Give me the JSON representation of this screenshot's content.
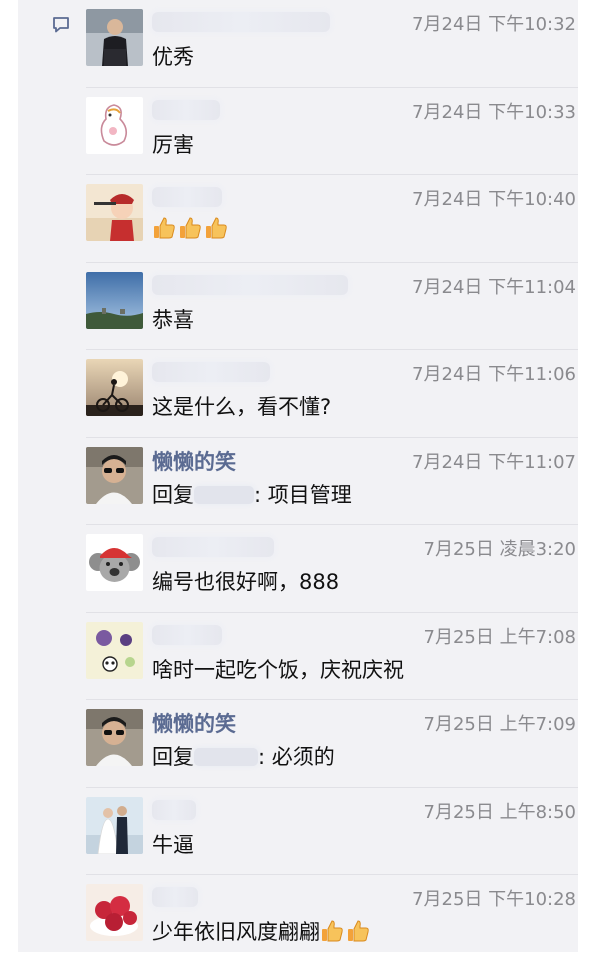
{
  "comments": [
    {
      "name": "",
      "name_hidden": true,
      "date": "7月24日 下午10:32",
      "text": "优秀",
      "avatar": "man-black-shirt-avatar"
    },
    {
      "name": "",
      "name_hidden": true,
      "date": "7月24日 下午10:33",
      "text": "厉害",
      "avatar": "cartoon-duck-avatar"
    },
    {
      "name": "",
      "name_hidden": true,
      "date": "7月24日 下午10:40",
      "text": "",
      "thumbs": 3,
      "avatar": "cartoon-official-avatar"
    },
    {
      "name": "",
      "name_hidden": true,
      "date": "7月24日 下午11:04",
      "text": "恭喜",
      "avatar": "sky-landscape-avatar"
    },
    {
      "name": "",
      "name_hidden": true,
      "date": "7月24日 下午11:06",
      "text": "这是什么，看不懂?",
      "avatar": "sunset-cyclist-avatar"
    },
    {
      "name": "懒懒的笑",
      "name_hidden": false,
      "date": "7月24日 下午11:07",
      "reply_prefix": "回复",
      "reply_suffix": ": 项目管理",
      "avatar": "man-sunglasses-avatar"
    },
    {
      "name": "",
      "name_hidden": true,
      "date": "7月25日 凌晨3:20",
      "text": "编号也很好啊，888",
      "avatar": "koala-cap-avatar"
    },
    {
      "name": "",
      "name_hidden": true,
      "date": "7月25日 上午7:08",
      "text": "啥时一起吃个饭，庆祝庆祝",
      "avatar": "cartoon-animals-avatar"
    },
    {
      "name": "懒懒的笑",
      "name_hidden": false,
      "date": "7月25日 上午7:09",
      "reply_prefix": "回复",
      "reply_suffix": ": 必须的",
      "avatar": "man-sunglasses-avatar"
    },
    {
      "name": "",
      "name_hidden": true,
      "date": "7月25日 上午8:50",
      "text": "牛逼",
      "avatar": "wedding-couple-avatar"
    },
    {
      "name": "",
      "name_hidden": true,
      "date": "7月25日 下午10:28",
      "text": "少年依旧风度翩翩",
      "thumbs": 2,
      "avatar": "strawberries-avatar"
    }
  ]
}
